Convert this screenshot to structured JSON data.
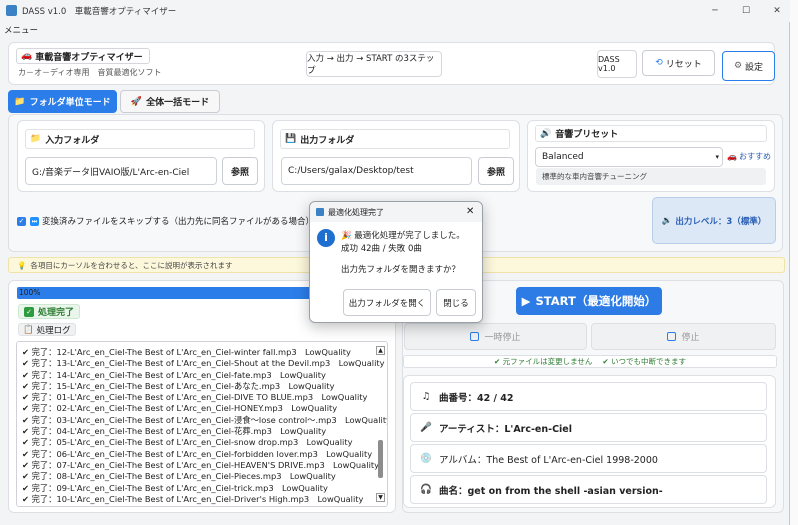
{
  "window": {
    "title": "DASS v1.0　車載音響オプティマイザー",
    "menu": "メニュー"
  },
  "header": {
    "app_name": "車載音響オプティマイザー",
    "subtitle": "カ－オ－ディオ専用　音質最適化ソフト",
    "steps": "入力 → 出力 → START の3ステップ",
    "version": "DASS v1.0",
    "reset_label": "リセット",
    "settings_label": "設定"
  },
  "tabs": [
    {
      "label": "フォルダ単位モード",
      "active": true
    },
    {
      "label": "全体一括モード",
      "active": false
    }
  ],
  "input_folder": {
    "label": "入力フォルダ",
    "value": "G:/音楽データ旧VAIO版/L'Arc-en-Ciel",
    "browse": "参照"
  },
  "output_folder": {
    "label": "出力フォルダ",
    "value": "C:/Users/galax/Desktop/test",
    "browse": "参照"
  },
  "preset": {
    "label": "音響プリセット",
    "selected": "Balanced",
    "recommend": "おすすめ",
    "description": "標準的な車内音響チューニング"
  },
  "skip_checkbox": {
    "checked": true,
    "label": "変換済みファイルをスキップする（出力先に同名ファイルがある場合）"
  },
  "output_level": "出力レベル：3（標準）",
  "hint": "各項目にカーソルを合わせると、ここに説明が表示されます",
  "progress": {
    "value": 1.0,
    "text": "100%"
  },
  "status": "処理完了",
  "log_label": "処理ログ",
  "log_lines": [
    "✔ 完了：12-L'Arc_en_Ciel-The Best of L'Arc_en_Ciel-winter fall.mp3　LowQuality",
    "✔ 完了：13-L'Arc_en_Ciel-The Best of L'Arc_en_Ciel-Shout at the Devil.mp3　LowQuality",
    "✔ 完了：14-L'Arc_en_Ciel-The Best of L'Arc_en_Ciel-fate.mp3　LowQuality",
    "✔ 完了：15-L'Arc_en_Ciel-The Best of L'Arc_en_Ciel-あなた.mp3　LowQuality",
    "✔ 完了：01-L'Arc_en_Ciel-The Best of L'Arc_en_Ciel-DIVE TO BLUE.mp3　LowQuality",
    "✔ 完了：02-L'Arc_en_Ciel-The Best of L'Arc_en_Ciel-HONEY.mp3　LowQuality",
    "✔ 完了：03-L'Arc_en_Ciel-The Best of L'Arc_en_Ciel-浸食～lose control～.mp3　LowQuality",
    "✔ 完了：04-L'Arc_en_Ciel-The Best of L'Arc_en_Ciel-花葬.mp3　LowQuality",
    "✔ 完了：05-L'Arc_en_Ciel-The Best of L'Arc_en_Ciel-snow drop.mp3　LowQuality",
    "✔ 完了：06-L'Arc_en_Ciel-The Best of L'Arc_en_Ciel-forbidden lover.mp3　LowQuality",
    "✔ 完了：07-L'Arc_en_Ciel-The Best of L'Arc_en_Ciel-HEAVEN'S DRIVE.mp3　LowQuality",
    "✔ 完了：08-L'Arc_en_Ciel-The Best of L'Arc_en_Ciel-Pieces.mp3　LowQuality",
    "✔ 完了：09-L'Arc_en_Ciel-The Best of L'Arc_en_Ciel-trick.mp3　LowQuality",
    "✔ 完了：10-L'Arc_en_Ciel-The Best of L'Arc_en_Ciel-Driver's High.mp3　LowQuality"
  ],
  "start_label": "START（最適化開始）",
  "pause_label": "一時停止",
  "stop_label": "停止",
  "notes": {
    "original": "✔ 元ファイルは変更しません",
    "interrupt": "✔ いつでも中断できます"
  },
  "track_info": {
    "number": "曲番号：42 / 42",
    "artist": "アーティスト：L'Arc-en-Ciel",
    "album": "アルバム：The Best of L'Arc-en-Ciel 1998-2000",
    "title": "曲名：get on from the shell -asian version-"
  },
  "dialog": {
    "title": "最適化処理完了",
    "line1": "🎉 最適化処理が完了しました。",
    "line2": "成功 42曲 / 失敗 0曲",
    "line3": "出力先フォルダを開きますか？",
    "open_button": "出力フォルダを開く",
    "close_button": "閉じる"
  },
  "colors": {
    "accent": "#2b7de9",
    "start": "#2d7be5",
    "success": "#2e9b3f",
    "level_bg": "#dde8f7"
  }
}
